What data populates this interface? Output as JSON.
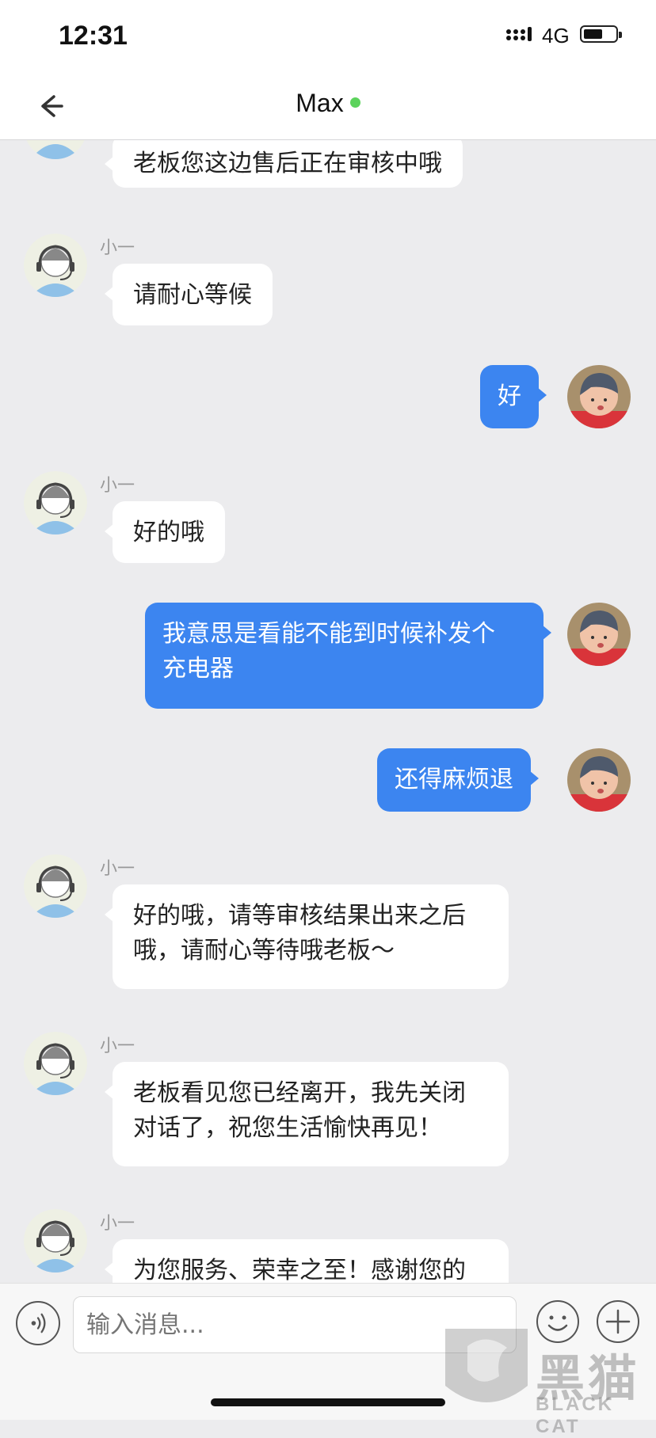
{
  "status": {
    "time": "12:31",
    "network": "4G",
    "battery_level": 0.6
  },
  "header": {
    "title": "Max",
    "online": true
  },
  "messages": [
    {
      "side": "in",
      "sender": "",
      "text": "老板您这边售后正在审核中哦"
    },
    {
      "side": "in",
      "sender": "小一",
      "text": "请耐心等候"
    },
    {
      "side": "out",
      "text": "好"
    },
    {
      "side": "in",
      "sender": "小一",
      "text": "好的哦"
    },
    {
      "side": "out",
      "line1": "我意思是看能不能到时候补发个",
      "line2": "充电器"
    },
    {
      "side": "out",
      "text": "还得麻烦退"
    },
    {
      "side": "in",
      "sender": "小一",
      "line1": "好的哦，请等审核结果出来之后",
      "line2": "哦，请耐心等待哦老板～"
    },
    {
      "side": "in",
      "sender": "小一",
      "line1": "老板看见您已经离开，我先关闭",
      "line2": "对话了，祝您生活愉快再见！"
    },
    {
      "side": "in",
      "sender": "小一",
      "text": "为您服务、荣幸之至！感谢您的"
    }
  ],
  "input": {
    "placeholder": "输入消息..."
  },
  "icons": {
    "back": "arrow-left-icon",
    "voice": "voice-icon",
    "emoji": "smiley-icon",
    "plus": "plus-icon",
    "agent_avatar": "support-agent-icon",
    "user_avatar": "user-photo"
  },
  "watermark": {
    "cn": "黑猫",
    "en": "BLACK CAT"
  },
  "colors": {
    "outgoing": "#3c85f0",
    "incoming": "#ffffff",
    "background": "#ececee",
    "online": "#5cd35c"
  }
}
